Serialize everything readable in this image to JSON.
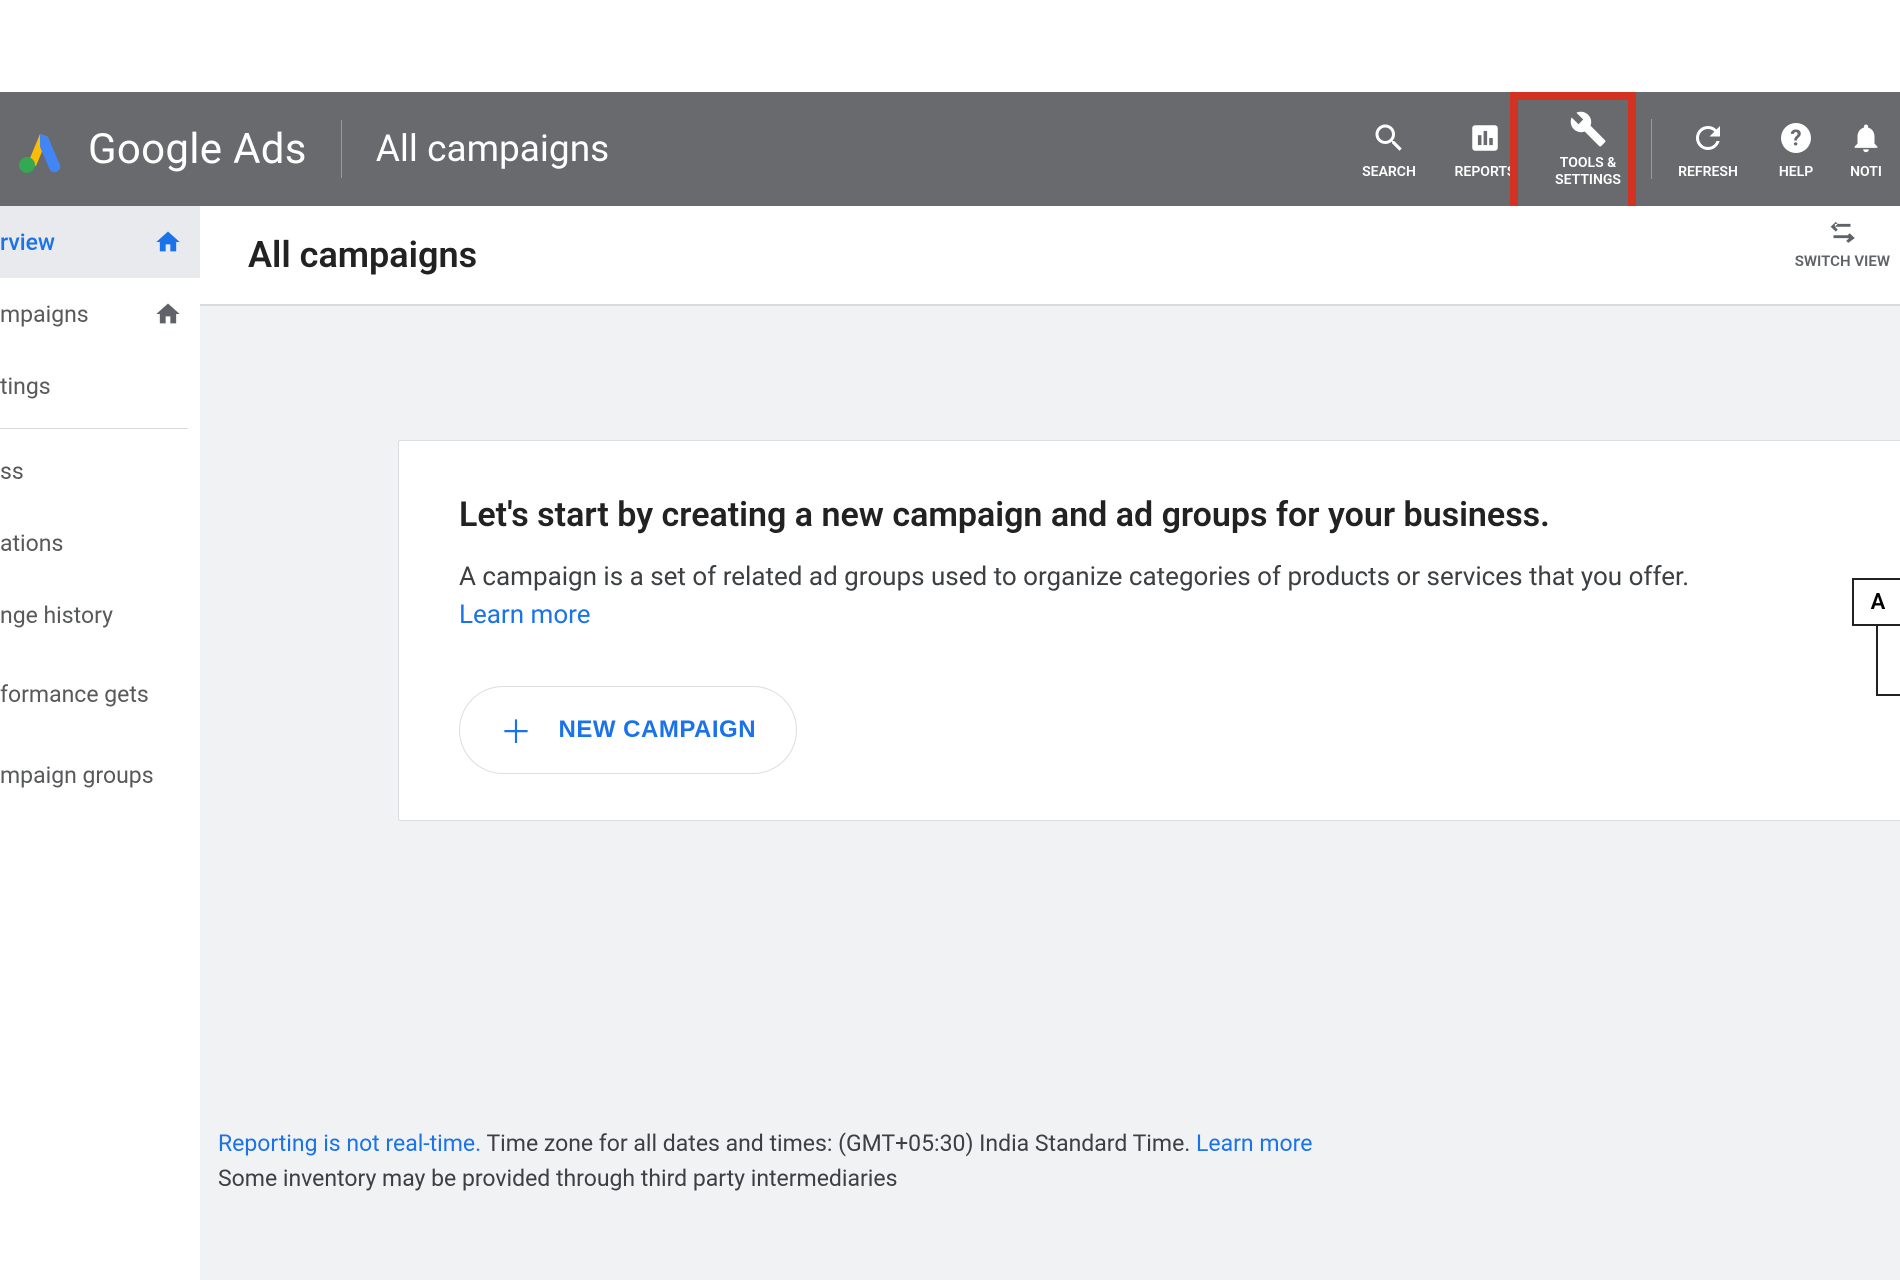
{
  "header": {
    "brand": "Google Ads",
    "context": "All campaigns",
    "actions": {
      "search": "SEARCH",
      "reports": "REPORTS",
      "tools": "TOOLS &\nSETTINGS",
      "refresh": "REFRESH",
      "help": "HELP",
      "notifications": "NOTI"
    }
  },
  "page": {
    "title": "All campaigns",
    "switch_view": "SWITCH VIEW"
  },
  "sidebar": {
    "items": [
      {
        "label": "rview",
        "home": true,
        "active": true
      },
      {
        "label": "mpaigns",
        "home": true,
        "active": false
      },
      {
        "label": "tings",
        "home": false,
        "active": false
      }
    ],
    "items2": [
      {
        "label": "ss"
      },
      {
        "label": "ations"
      },
      {
        "label": "nge history"
      },
      {
        "label": "formance\ngets"
      },
      {
        "label": "mpaign groups"
      }
    ]
  },
  "card": {
    "heading": "Let's start by creating a new campaign and ad groups for your business.",
    "body": "A campaign is a set of related ad groups used to organize categories of products or services that you offer.",
    "learn_more": "Learn more",
    "new_campaign": "NEW CAMPAIGN"
  },
  "rightbox_label": "A",
  "footer": {
    "line1_link": "Reporting is not real-time.",
    "line1_rest": " Time zone for all dates and times: (GMT+05:30) India Standard Time. ",
    "line1_learn": "Learn more",
    "line2": "Some inventory may be provided through third party intermediaries"
  },
  "colors": {
    "accent": "#1a73e8",
    "header_bg": "#696a6d",
    "highlight": "#d13222",
    "arrow": "#2a9b3d"
  }
}
